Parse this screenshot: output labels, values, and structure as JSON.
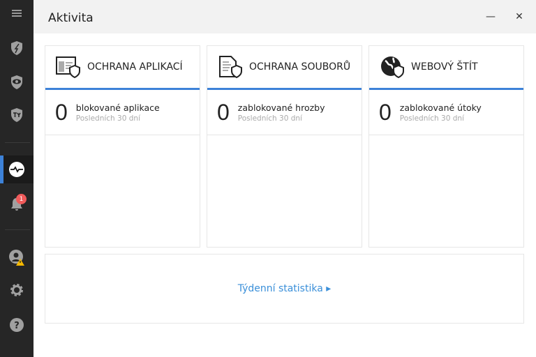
{
  "window": {
    "title": "Aktivita",
    "minimize": "—",
    "close": "✕"
  },
  "sidebar": {
    "notification_count": "1",
    "items": [
      "menu-icon",
      "app-shield-icon",
      "eye-shield-icon",
      "ty-shield-icon",
      "activity-icon",
      "bell-icon",
      "account-warning-icon",
      "gear-icon",
      "help-icon"
    ]
  },
  "cards": [
    {
      "title": "OCHRANA APLIKACÍ",
      "count": "0",
      "label": "blokované aplikace",
      "period": "Posledních 30 dní"
    },
    {
      "title": "OCHRANA SOUBORŮ",
      "count": "0",
      "label": "zablokované hrozby",
      "period": "Posledních 30 dní"
    },
    {
      "title": "WEBOVÝ ŠTÍT",
      "count": "0",
      "label": "zablokované útoky",
      "period": "Posledních 30 dní"
    }
  ],
  "weekly": {
    "label": "Týdenní statistika",
    "arrow": "▸"
  },
  "colors": {
    "accent": "#3d82d8",
    "link": "#3a8fd9",
    "sidebar": "#262626",
    "badge": "#f05a5a"
  }
}
